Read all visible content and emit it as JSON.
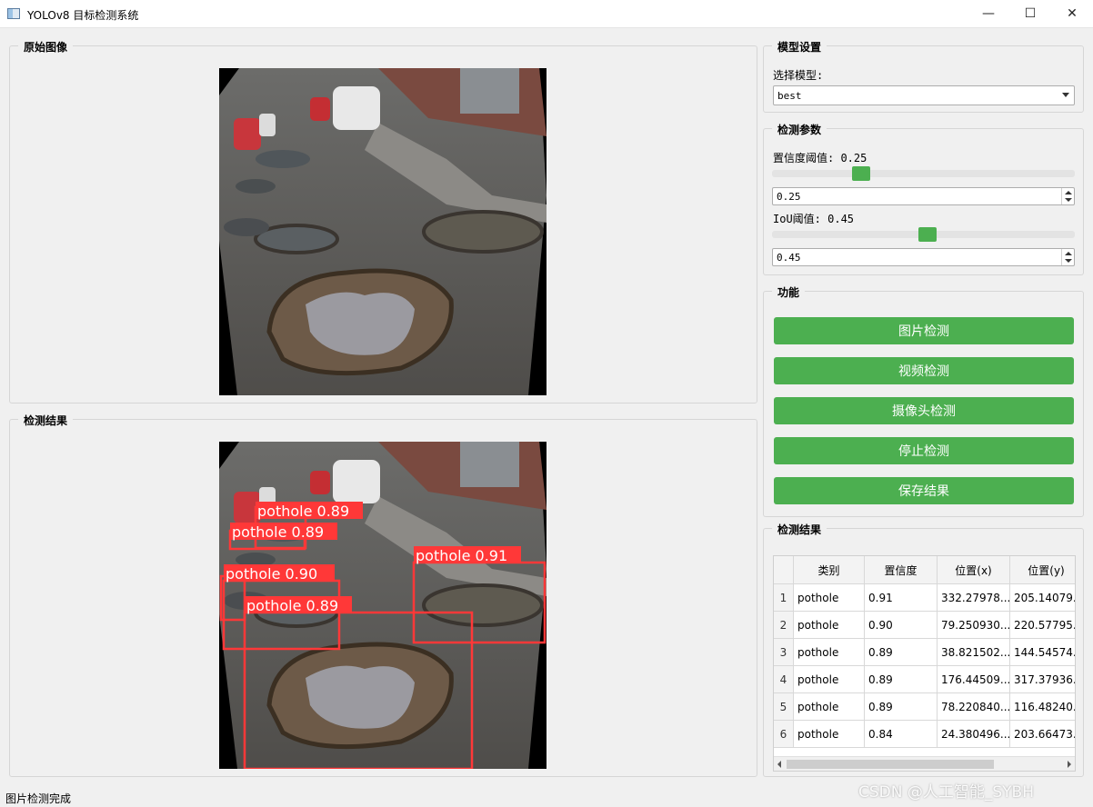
{
  "window": {
    "title": "YOLOv8 目标检测系统",
    "min_glyph": "—",
    "max_glyph": "☐",
    "close_glyph": "✕"
  },
  "original": {
    "title": "原始图像"
  },
  "result_image": {
    "title": "检测结果",
    "detections": [
      {
        "label": "pothole 0.91"
      },
      {
        "label": "pothole 0.90"
      },
      {
        "label": "pothole 0.89"
      },
      {
        "label": "pothole 0.89"
      },
      {
        "label": "pothole 0.89"
      }
    ]
  },
  "model": {
    "title": "模型设置",
    "label": "选择模型:",
    "selected": "best"
  },
  "params": {
    "title": "检测参数",
    "conf_label": "置信度阈值: 0.25",
    "conf_value": "0.25",
    "conf_level": 0.25,
    "iou_label": "IoU阈值: 0.45",
    "iou_value": "0.45",
    "iou_level": 0.45
  },
  "functions": {
    "title": "功能",
    "image_detect": "图片检测",
    "video_detect": "视频检测",
    "camera_detect": "摄像头检测",
    "stop_detect": "停止检测",
    "save_result": "保存结果"
  },
  "table": {
    "title": "检测结果",
    "headers": [
      "类别",
      "置信度",
      "位置(x)",
      "位置(y)"
    ],
    "rows": [
      {
        "idx": "1",
        "cls": "pothole",
        "conf": "0.91",
        "x": "332.27978...",
        "y": "205.14079..."
      },
      {
        "idx": "2",
        "cls": "pothole",
        "conf": "0.90",
        "x": "79.250930...",
        "y": "220.57795..."
      },
      {
        "idx": "3",
        "cls": "pothole",
        "conf": "0.89",
        "x": "38.821502...",
        "y": "144.54574..."
      },
      {
        "idx": "4",
        "cls": "pothole",
        "conf": "0.89",
        "x": "176.44509...",
        "y": "317.37936..."
      },
      {
        "idx": "5",
        "cls": "pothole",
        "conf": "0.89",
        "x": "78.220840...",
        "y": "116.48240..."
      },
      {
        "idx": "6",
        "cls": "pothole",
        "conf": "0.84",
        "x": "24.380496...",
        "y": "203.66473..."
      }
    ]
  },
  "status": {
    "text": "图片检测完成"
  },
  "watermark": "CSDN @人工智能_SYBH"
}
